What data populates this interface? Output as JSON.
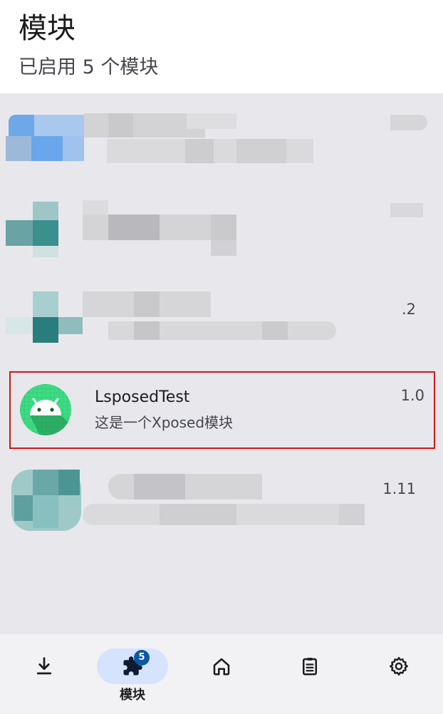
{
  "header": {
    "title": "模块",
    "subtitle": "已启用 5 个模块"
  },
  "modules": [
    {
      "name": "",
      "description": "",
      "version": ""
    },
    {
      "name": "",
      "description": "",
      "version": ""
    },
    {
      "name": "",
      "description": "",
      "version": ".2"
    },
    {
      "name": "LsposedTest",
      "description": "这是一个Xposed模块",
      "version": "1.0",
      "icon": "android-icon",
      "icon_color": "#3ddc84"
    },
    {
      "name": "",
      "description": "",
      "version": "1.11"
    }
  ],
  "bottom_nav": {
    "items": [
      {
        "icon": "download-icon",
        "label": ""
      },
      {
        "icon": "puzzle-icon",
        "label": "模块",
        "badge": "5",
        "active": true
      },
      {
        "icon": "home-icon",
        "label": ""
      },
      {
        "icon": "clipboard-icon",
        "label": ""
      },
      {
        "icon": "gear-icon",
        "label": ""
      }
    ]
  },
  "colors": {
    "background": "#e8e8ec",
    "header": "#ffffff",
    "accent": "#0b57a8",
    "active_pill": "#d6e3ff",
    "highlight_border": "#d01818"
  }
}
